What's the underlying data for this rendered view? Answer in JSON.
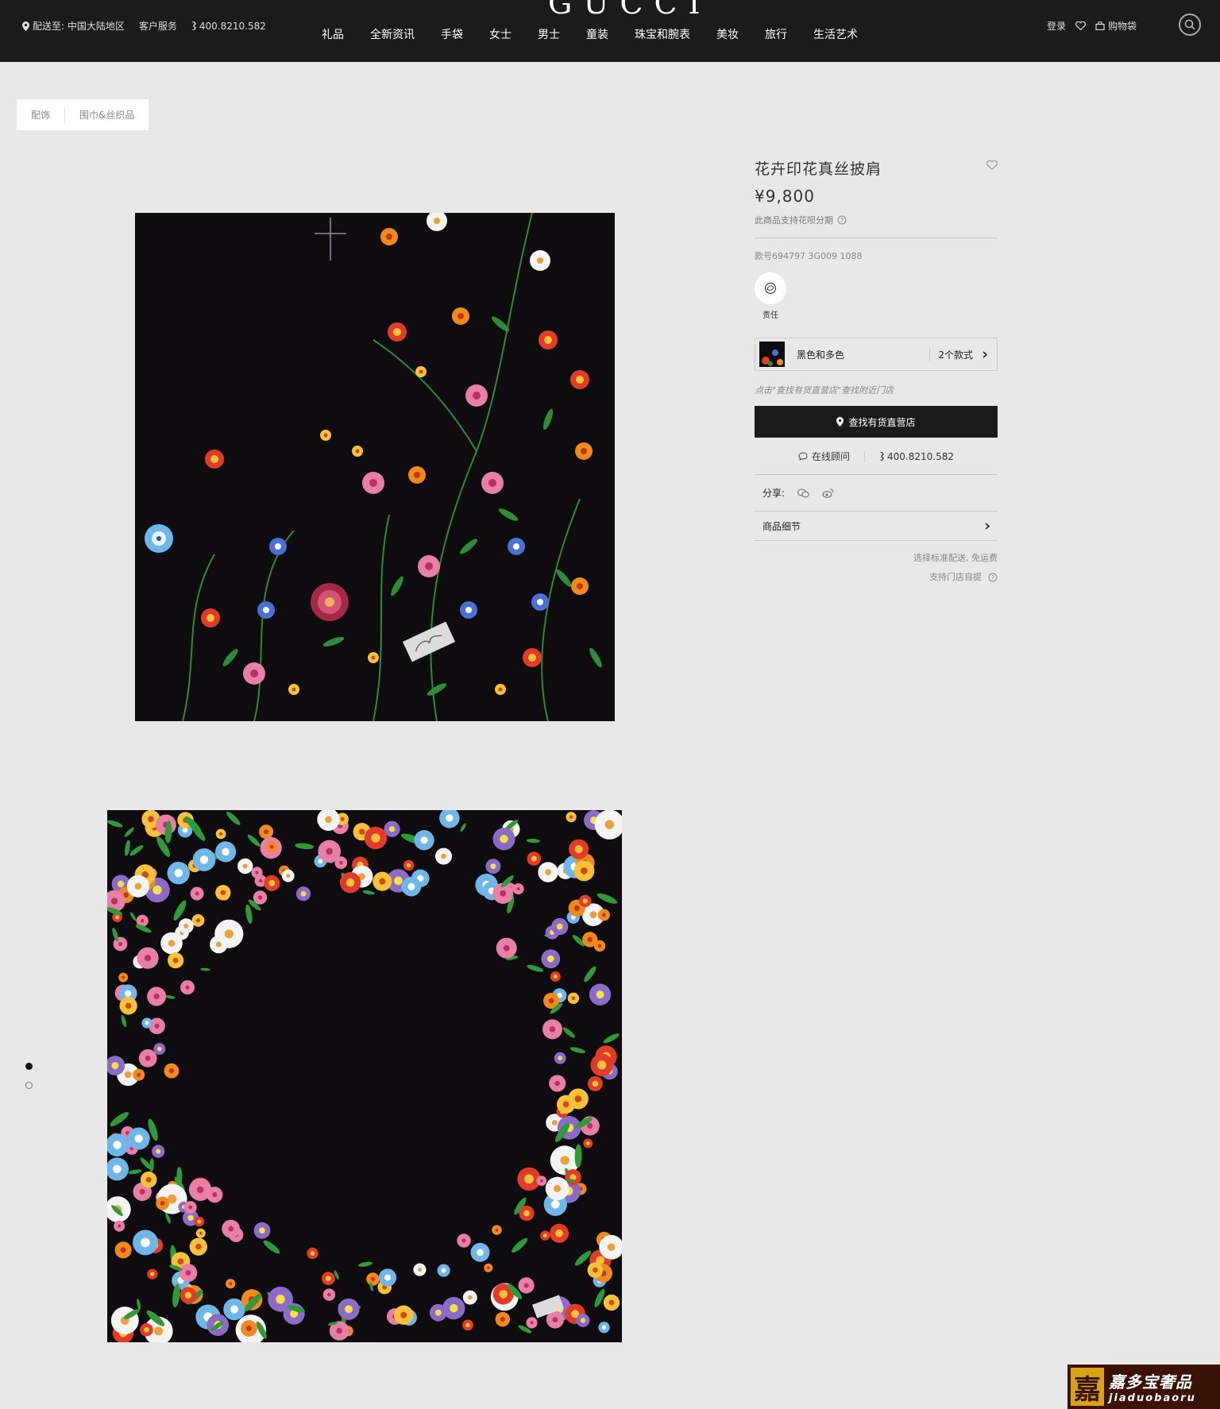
{
  "header": {
    "logo": "GUCCI",
    "ship_to": "配送至: 中国大陆地区",
    "customer_service": "客户服务",
    "phone": "400.8210.582",
    "nav": [
      "礼品",
      "全新资讯",
      "手袋",
      "女士",
      "男士",
      "童装",
      "珠宝和腕表",
      "美妆",
      "旅行",
      "生活艺术"
    ],
    "login": "登录",
    "bag": "购物袋"
  },
  "breadcrumb": [
    "配饰",
    "围巾&丝织品"
  ],
  "product": {
    "title": "花卉印花真丝披肩",
    "price": "¥9,800",
    "installment": "此商品支持花呗分期",
    "style_no": "款号694797 3G009 1088",
    "responsibility_label": "责任",
    "variant_name": "黑色和多色",
    "variant_count": "2个款式",
    "store_hint": "点击\"查找有货直营店\"查找附近门店",
    "store_button": "查找有货直营店",
    "online_consult": "在线顾问",
    "phone": "400.8210.582",
    "share_label": "分享:",
    "details_label": "商品细节",
    "shipping": "选择标准配送, 免运费",
    "pickup": "支持门店自提"
  },
  "gallery": {
    "active_index": 0,
    "total": 2
  },
  "watermark": {
    "icon_char": "嘉",
    "cn": "嘉多宝奢品",
    "en": "jiaduobaoru"
  },
  "colors": {
    "topbar": "#1b1b1b",
    "background": "#e8e8e8",
    "button": "#1b1b1b"
  }
}
